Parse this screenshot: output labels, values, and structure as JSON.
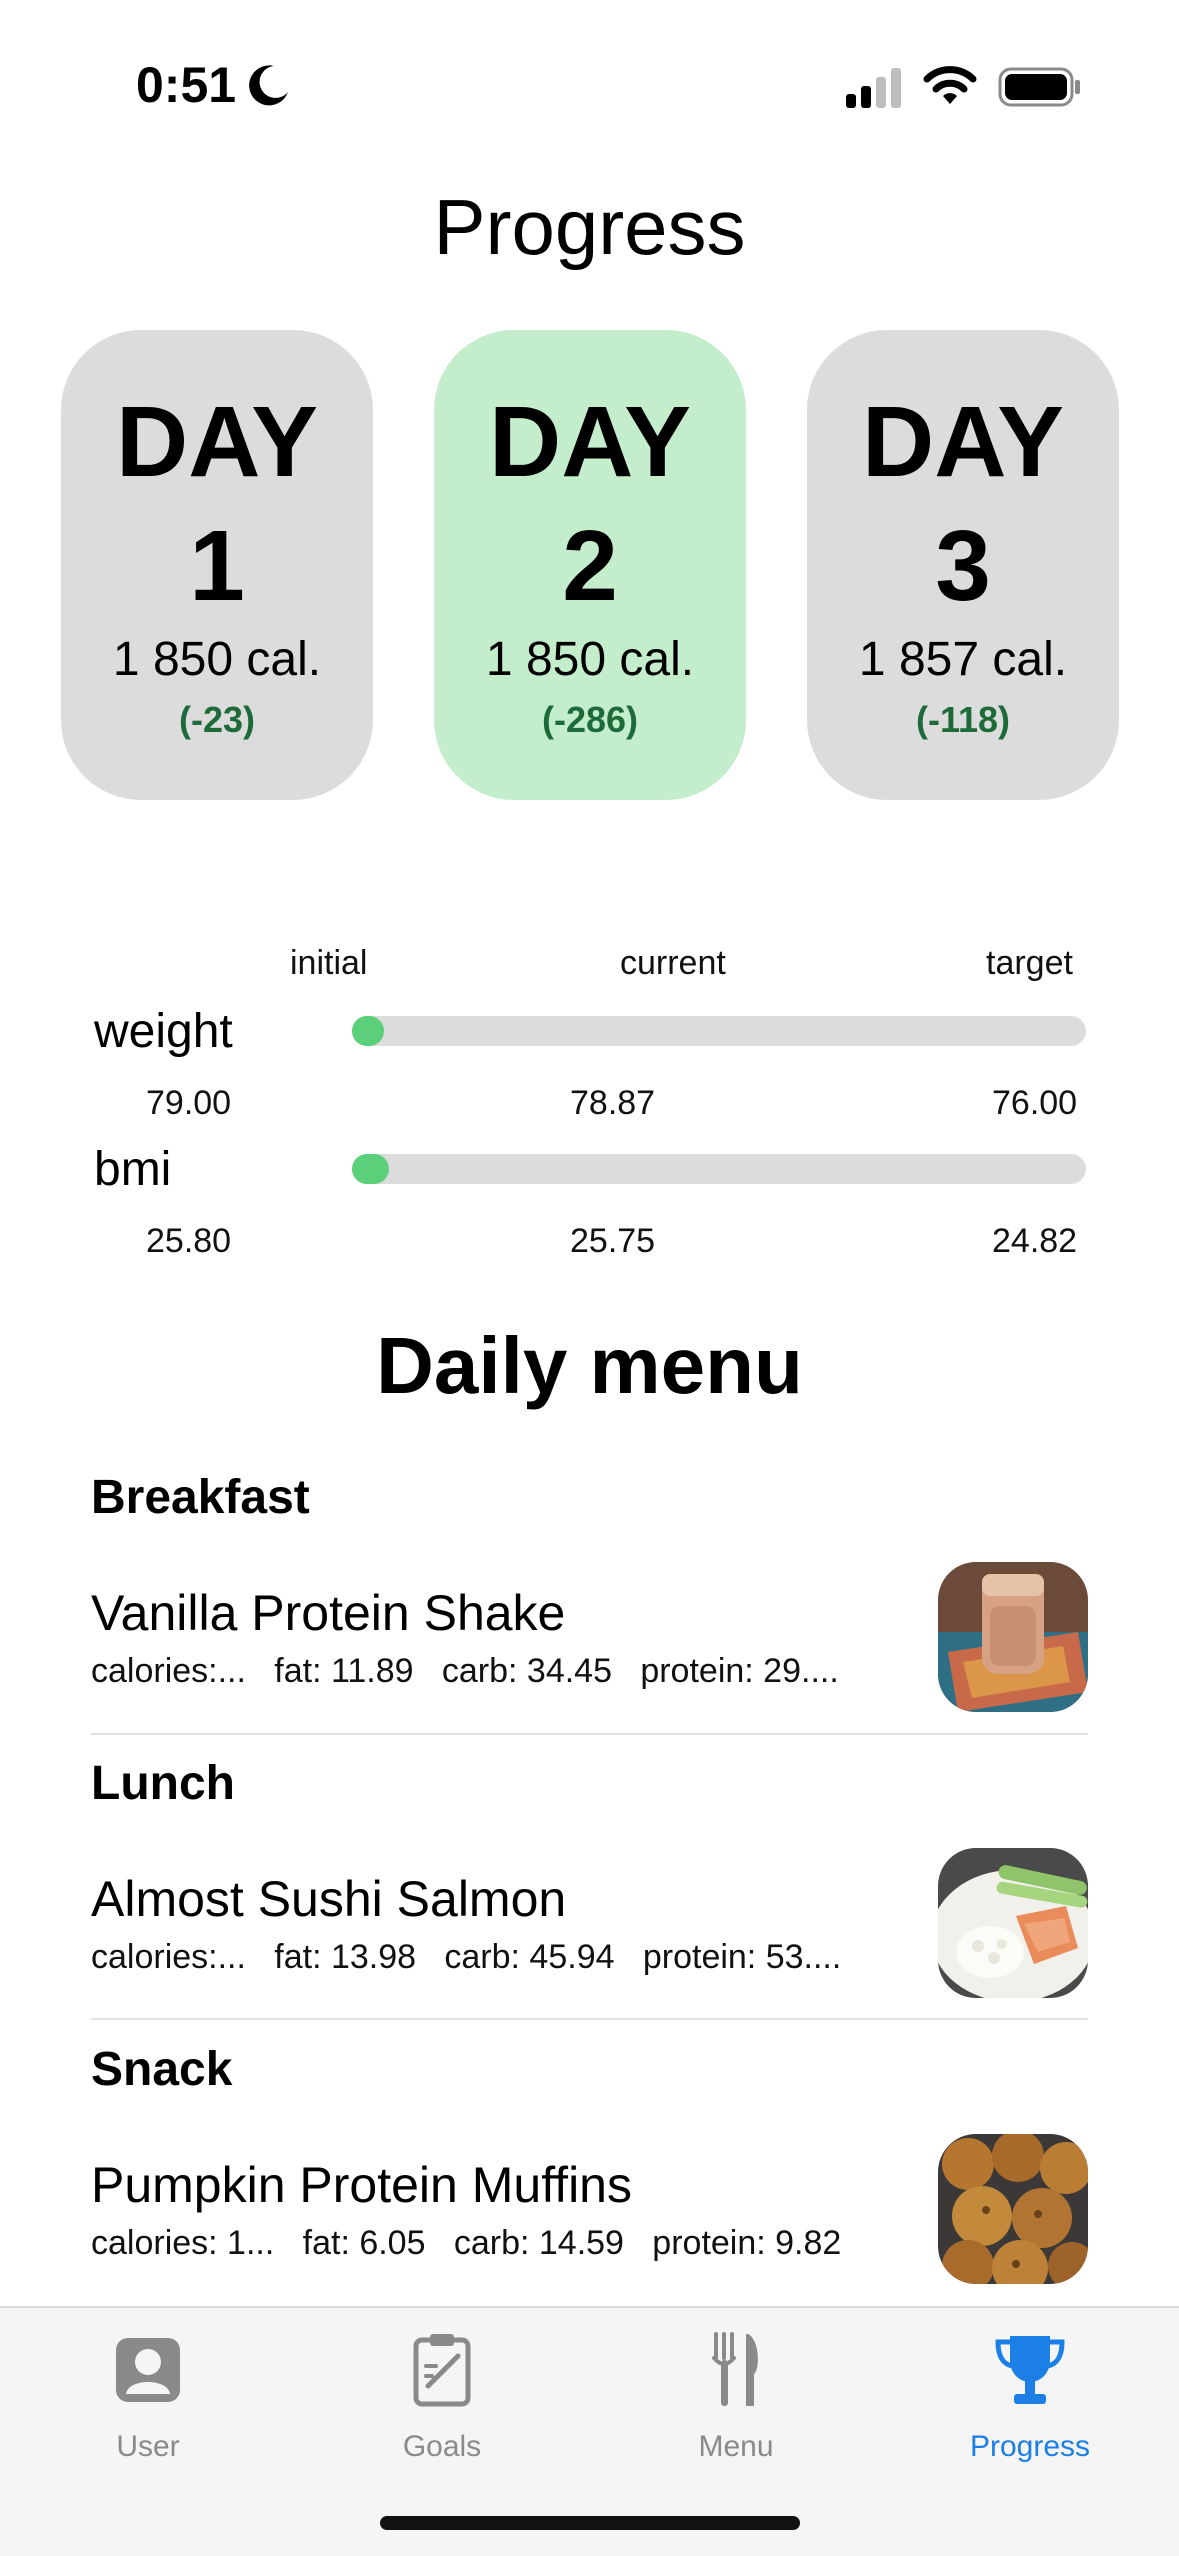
{
  "status_bar": {
    "time": "0:51"
  },
  "page_title": "Progress",
  "days": [
    {
      "word": "DAY",
      "number": "1",
      "calories": "1 850 cal.",
      "delta": "(-23)"
    },
    {
      "word": "DAY",
      "number": "2",
      "calories": "1 850 cal.",
      "delta": "(-286)"
    },
    {
      "word": "DAY",
      "number": "3",
      "calories": "1 857 cal.",
      "delta": "(-118)"
    }
  ],
  "progress": {
    "headers": {
      "initial": "initial",
      "current": "current",
      "target": "target"
    },
    "rows": [
      {
        "label": "weight",
        "initial": "79.00",
        "current": "78.87",
        "target": "76.00",
        "fraction": 0.043
      },
      {
        "label": "bmi",
        "initial": "25.80",
        "current": "25.75",
        "target": "24.82",
        "fraction": 0.051
      }
    ],
    "fill_color": "#5bcf7a"
  },
  "daily_menu": {
    "title": "Daily menu",
    "meals": [
      {
        "meal": "Breakfast",
        "name": "Vanilla Protein Shake",
        "macros": "calories:...   fat: 11.89   carb: 34.45   protein: 29...."
      },
      {
        "meal": "Lunch",
        "name": "Almost Sushi Salmon",
        "macros": "calories:...   fat: 13.98   carb: 45.94   protein: 53...."
      },
      {
        "meal": "Snack",
        "name": "Pumpkin Protein Muffins",
        "macros": "calories: 1...   fat: 6.05   carb: 14.59   protein: 9.82"
      }
    ]
  },
  "tabbar": {
    "tabs": [
      {
        "label": "User",
        "icon": "user-icon"
      },
      {
        "label": "Goals",
        "icon": "goals-icon"
      },
      {
        "label": "Menu",
        "icon": "fork-knife-icon"
      },
      {
        "label": "Progress",
        "icon": "trophy-icon"
      }
    ],
    "active_color": "#1c7fe6",
    "inactive_color": "#8a8a8a"
  },
  "colors": {
    "active_day": "#c4edcc",
    "inactive_day": "#dcdcdc",
    "delta_text": "#1e6b3a"
  }
}
